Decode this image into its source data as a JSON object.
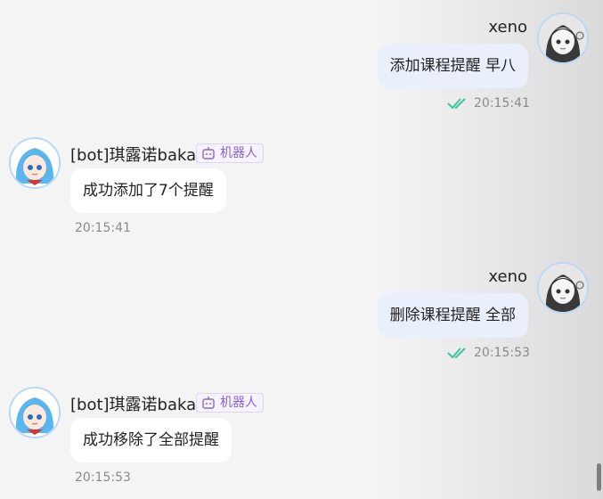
{
  "messages": [
    {
      "sender": "xeno",
      "text": "添加课程提醒 早八",
      "time": "20:15:41",
      "read": true
    },
    {
      "sender": "[bot]琪露诺baka",
      "tag": "机器人",
      "text": "成功添加了7个提醒",
      "time": "20:15:41"
    },
    {
      "sender": "xeno",
      "text": "删除课程提醒 全部",
      "time": "20:15:53",
      "read": true
    },
    {
      "sender": "[bot]琪露诺baka",
      "tag": "机器人",
      "text": "成功移除了全部提醒",
      "time": "20:15:53"
    }
  ],
  "colors": {
    "self_bubble": "#eaf0fb",
    "bot_bubble": "#ffffff",
    "read_check": "#3cc7a0",
    "bot_tag": "#8a63d2"
  },
  "icons": {
    "read_receipt": "double-check-icon",
    "bot_tag": "robot-icon"
  }
}
